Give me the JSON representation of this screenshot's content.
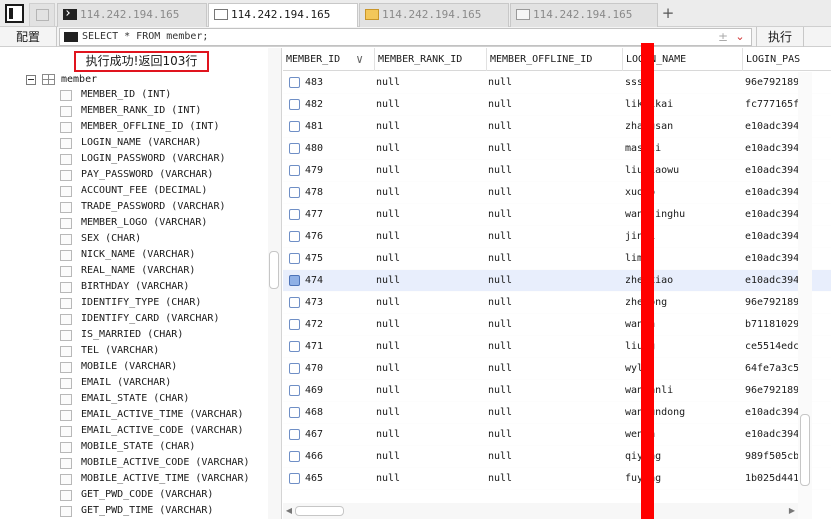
{
  "tabs": [
    {
      "label": "114.242.194.165",
      "icon": "terminal-icon",
      "active": false
    },
    {
      "label": "114.242.194.165",
      "icon": "document-icon",
      "active": true
    },
    {
      "label": "114.242.194.165",
      "icon": "folder-icon",
      "active": false
    },
    {
      "label": "114.242.194.165",
      "icon": "query-icon",
      "active": false
    }
  ],
  "toolbar": {
    "config_label": "配置",
    "sql": "SELECT * FROM member;",
    "plus_minus": "±",
    "chevron": "⌄",
    "execute_label": "执行"
  },
  "status": {
    "message": "执行成功!返回103行"
  },
  "tree": {
    "table_name": "member",
    "columns": [
      "MEMBER_ID (INT)",
      "MEMBER_RANK_ID (INT)",
      "MEMBER_OFFLINE_ID (INT)",
      "LOGIN_NAME (VARCHAR)",
      "LOGIN_PASSWORD (VARCHAR)",
      "PAY_PASSWORD (VARCHAR)",
      "ACCOUNT_FEE (DECIMAL)",
      "TRADE_PASSWORD (VARCHAR)",
      "MEMBER_LOGO (VARCHAR)",
      "SEX (CHAR)",
      "NICK_NAME (VARCHAR)",
      "REAL_NAME (VARCHAR)",
      "BIRTHDAY (VARCHAR)",
      "IDENTIFY_TYPE (CHAR)",
      "IDENTIFY_CARD (VARCHAR)",
      "IS_MARRIED (CHAR)",
      "TEL (VARCHAR)",
      "MOBILE (VARCHAR)",
      "EMAIL (VARCHAR)",
      "EMAIL_STATE (CHAR)",
      "EMAIL_ACTIVE_TIME (VARCHAR)",
      "EMAIL_ACTIVE_CODE (VARCHAR)",
      "MOBILE_STATE (CHAR)",
      "MOBILE_ACTIVE_CODE (VARCHAR)",
      "MOBILE_ACTIVE_TIME (VARCHAR)",
      "GET_PWD_CODE (VARCHAR)",
      "GET_PWD_TIME (VARCHAR)"
    ]
  },
  "grid": {
    "headers": [
      "MEMBER_ID",
      "MEMBER_RANK_ID",
      "MEMBER_OFFLINE_ID",
      "LOGIN_NAME",
      "LOGIN_PAS"
    ],
    "sort_icon": "∨",
    "selected_id": "474",
    "rows": [
      {
        "id": "483",
        "rank": "null",
        "offline": "null",
        "name": "ssss",
        "pass": "96e792189"
      },
      {
        "id": "482",
        "rank": "null",
        "offline": "null",
        "name": "likaikai",
        "pass": "fc777165f"
      },
      {
        "id": "481",
        "rank": "null",
        "offline": "null",
        "name": "zhangsan",
        "pass": "e10adc394"
      },
      {
        "id": "480",
        "rank": "null",
        "offline": "null",
        "name": "masuli",
        "pass": "e10adc394"
      },
      {
        "id": "479",
        "rank": "null",
        "offline": "null",
        "name": "liuxiaowu",
        "pass": "e10adc394"
      },
      {
        "id": "478",
        "rank": "null",
        "offline": "null",
        "name": "xuobo",
        "pass": "e10adc394"
      },
      {
        "id": "477",
        "rank": "null",
        "offline": "null",
        "name": "wangjinghu",
        "pass": "e10adc394"
      },
      {
        "id": "476",
        "rank": "null",
        "offline": "null",
        "name": "jinli",
        "pass": "e10adc394"
      },
      {
        "id": "475",
        "rank": "null",
        "offline": "null",
        "name": "limi",
        "pass": "e10adc394"
      },
      {
        "id": "474",
        "rank": "null",
        "offline": "null",
        "name": "zhenxiao",
        "pass": "e10adc394"
      },
      {
        "id": "473",
        "rank": "null",
        "offline": "null",
        "name": "zhenong",
        "pass": "96e792189"
      },
      {
        "id": "472",
        "rank": "null",
        "offline": "null",
        "name": "wangh",
        "pass": "b71181029"
      },
      {
        "id": "471",
        "rank": "null",
        "offline": "null",
        "name": "liung",
        "pass": "ce5514edc"
      },
      {
        "id": "470",
        "rank": "null",
        "offline": "null",
        "name": "wyl3",
        "pass": "64fe7a3c5"
      },
      {
        "id": "469",
        "rank": "null",
        "offline": "null",
        "name": "wanganli",
        "pass": "96e792189"
      },
      {
        "id": "468",
        "rank": "null",
        "offline": "null",
        "name": "wangundong",
        "pass": "e10adc394"
      },
      {
        "id": "467",
        "rank": "null",
        "offline": "null",
        "name": "wenga",
        "pass": "e10adc394"
      },
      {
        "id": "466",
        "rank": "null",
        "offline": "null",
        "name": "qiyeng",
        "pass": "989f505cb"
      },
      {
        "id": "465",
        "rank": "null",
        "offline": "null",
        "name": "fuyang",
        "pass": "1b025d441"
      }
    ]
  },
  "colors": {
    "redaction": "#ff0000",
    "status_border": "#e0141e",
    "selected_row": "#e8eefc"
  }
}
